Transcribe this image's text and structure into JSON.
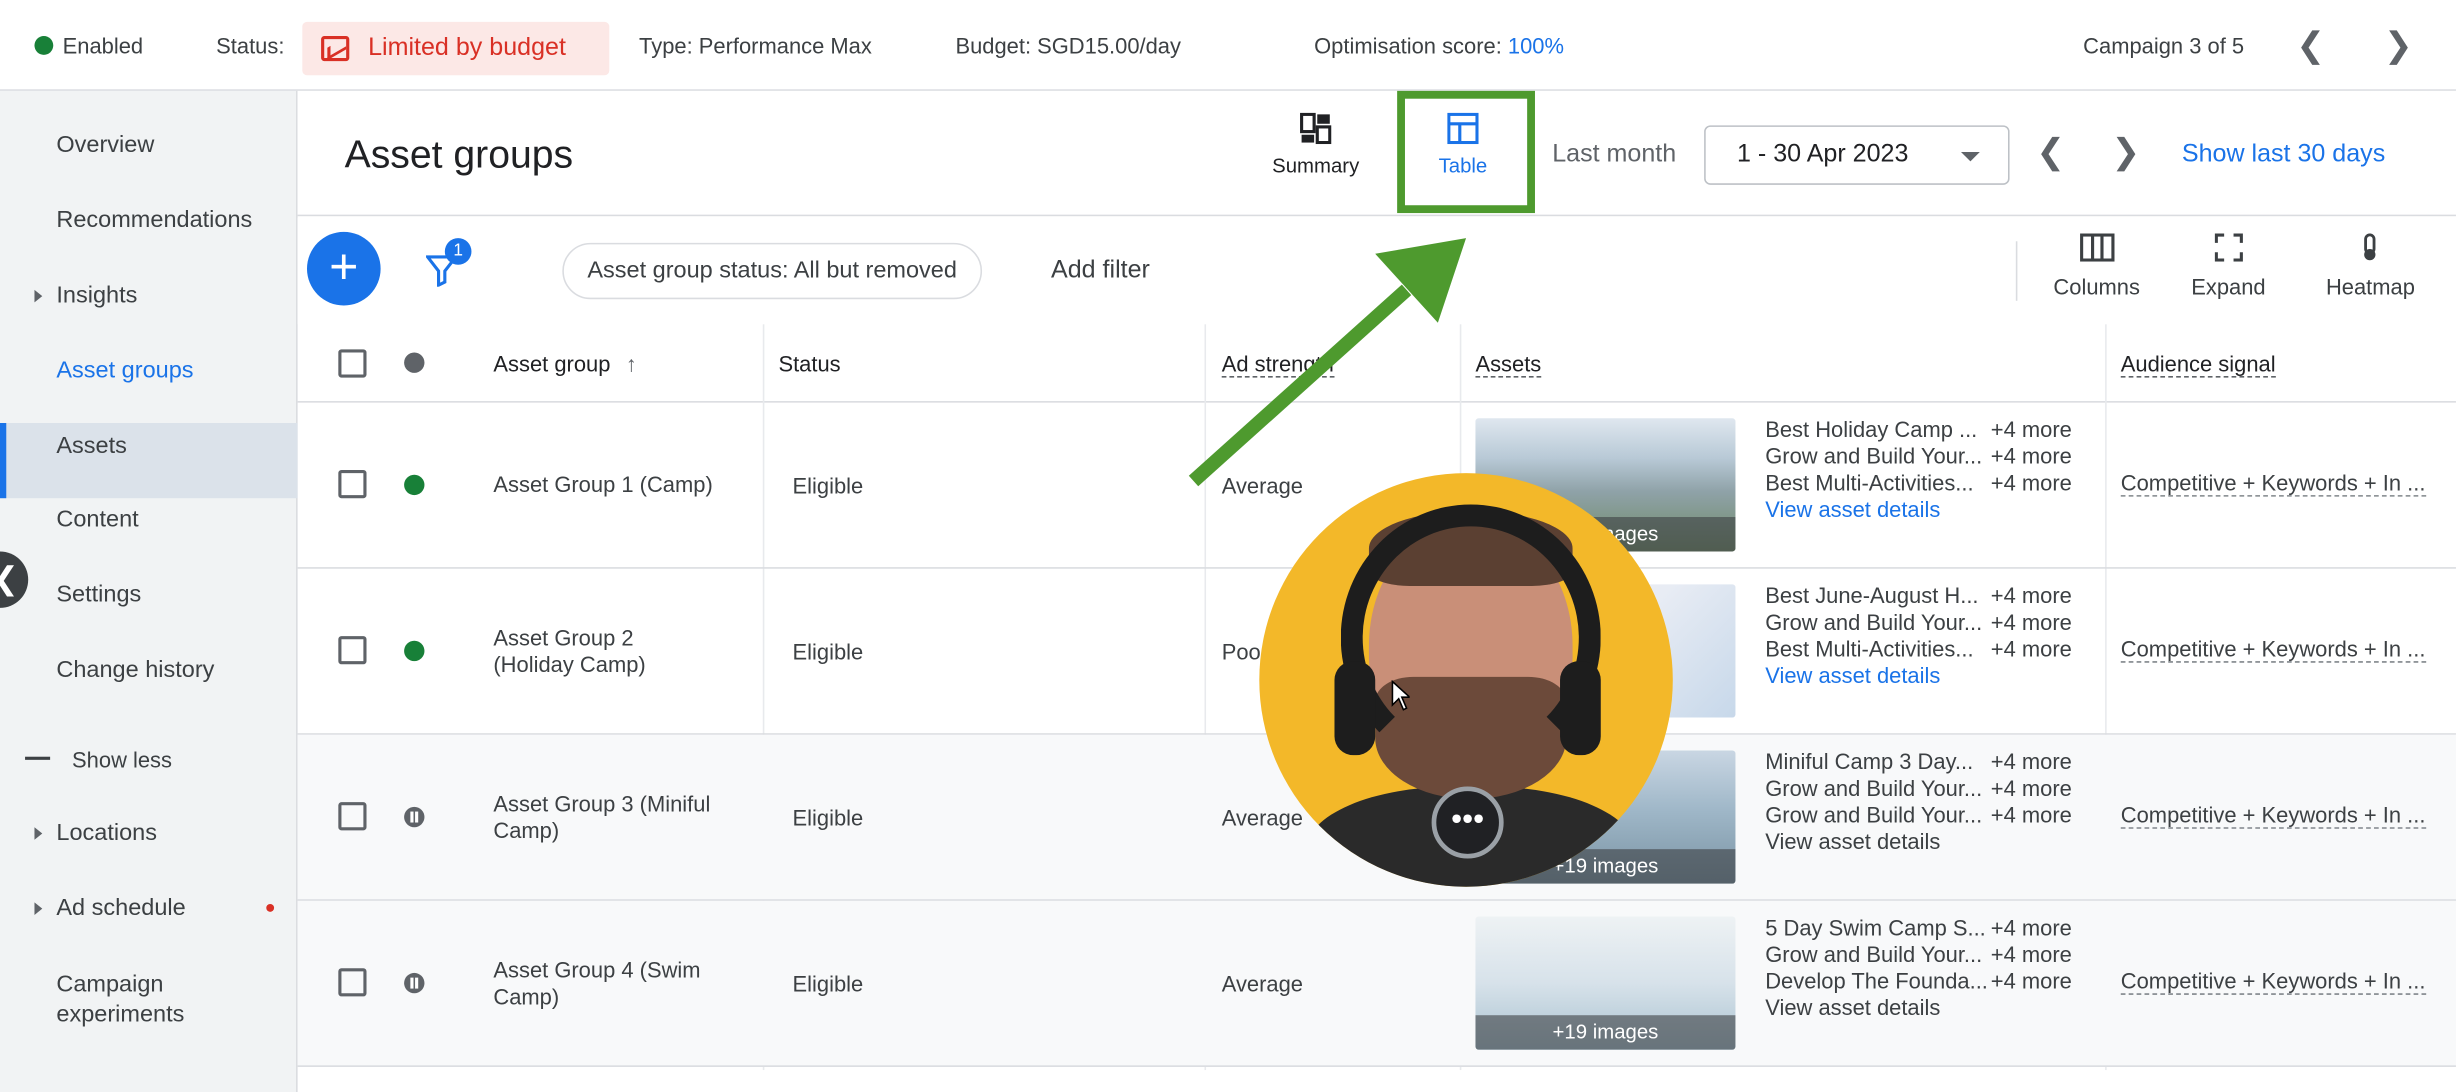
{
  "topbar": {
    "enabled": "Enabled",
    "status_label": "Status:",
    "status_value": "Limited by budget",
    "type": "Type: Performance Max",
    "budget": "Budget: SGD15.00/day",
    "optimisation_label": "Optimisation score:",
    "optimisation_value": "100%",
    "campaign_counter": "Campaign 3 of 5"
  },
  "sidebar": {
    "items": [
      {
        "label": "Overview"
      },
      {
        "label": "Recommendations"
      },
      {
        "label": "Insights"
      },
      {
        "label": "Asset groups"
      },
      {
        "label": "Assets"
      },
      {
        "label": "Content"
      },
      {
        "label": "Settings"
      },
      {
        "label": "Change history"
      },
      {
        "label": "Show less"
      },
      {
        "label": "Locations"
      },
      {
        "label": "Ad schedule"
      },
      {
        "label": "Campaign experiments"
      }
    ]
  },
  "header": {
    "title": "Asset groups",
    "summary_label": "Summary",
    "table_label": "Table",
    "date_preset": "Last month",
    "date_range": "1 - 30 Apr 2023",
    "show_last": "Show last 30 days"
  },
  "toolbar": {
    "filter_count": "1",
    "filter_chip": "Asset group status: All but removed",
    "add_filter": "Add filter",
    "columns": "Columns",
    "expand": "Expand",
    "heatmap": "Heatmap"
  },
  "table": {
    "headers": {
      "asset_group": "Asset group",
      "status": "Status",
      "ad_strength": "Ad strength",
      "assets": "Assets",
      "audience": "Audience signal"
    },
    "rows": [
      {
        "name_line1": "Asset Group 1 (Camp)",
        "name_line2": "",
        "status": "Eligible",
        "ad_strength": "Average",
        "images": "+19 images",
        "assets": [
          "Best Holiday Camp ...",
          "Grow and Build Your...",
          "Best Multi-Activities..."
        ],
        "more": [
          "+4 more",
          "+4 more",
          "+4 more"
        ],
        "view": "View asset details",
        "audience": "Competitive + Keywords + In ..."
      },
      {
        "name_line1": "Asset Group 2",
        "name_line2": "(Holiday Camp)",
        "status": "Eligible",
        "ad_strength": "Poor",
        "images": "",
        "assets": [
          "Best June-August H...",
          "Grow and Build Your...",
          "Best Multi-Activities..."
        ],
        "more": [
          "+4 more",
          "+4 more",
          "+4 more"
        ],
        "view": "View asset details",
        "audience": "Competitive + Keywords + In ..."
      },
      {
        "name_line1": "Asset Group 3 (Miniful",
        "name_line2": "Camp)",
        "status": "Eligible",
        "ad_strength": "Average",
        "images": "+19 images",
        "assets": [
          "Miniful Camp 3 Day...",
          "Grow and Build Your...",
          "Grow and Build Your..."
        ],
        "more": [
          "+4 more",
          "+4 more",
          "+4 more"
        ],
        "view": "View asset details",
        "audience": "Competitive + Keywords + In ..."
      },
      {
        "name_line1": "Asset Group 4 (Swim",
        "name_line2": "Camp)",
        "status": "Eligible",
        "ad_strength": "Average",
        "images": "+19 images",
        "assets": [
          "5 Day Swim Camp S...",
          "Grow and Build Your...",
          "Develop The Founda..."
        ],
        "more": [
          "+4 more",
          "+4 more",
          "+4 more"
        ],
        "view": "View asset details",
        "audience": "Competitive + Keywords + In ..."
      }
    ]
  },
  "colors": {
    "accent": "#1a73e8",
    "enabled_green": "#188038",
    "limited_red": "#d93025",
    "highlight_green": "#4e9a2e"
  }
}
